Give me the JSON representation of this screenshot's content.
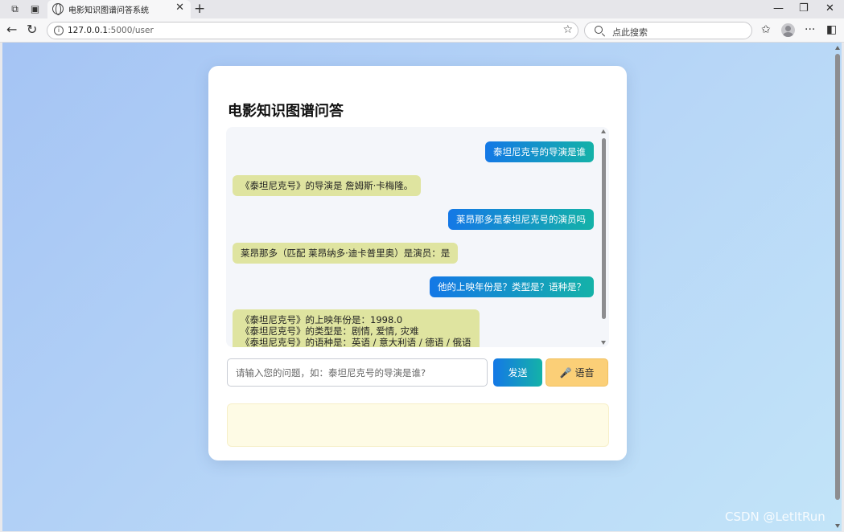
{
  "browser": {
    "tab_title": "电影知识图谱问答系统",
    "url_host": "127.0.0.1",
    "url_path": ":5000/user",
    "search_placeholder": "点此搜索",
    "tab_close": "✕",
    "new_tab": "+",
    "minimize": "—",
    "restore": "❐",
    "close": "✕"
  },
  "page": {
    "title": "电影知识图谱问答",
    "messages": [
      {
        "role": "user",
        "text": "泰坦尼克号的导演是谁"
      },
      {
        "role": "bot",
        "text": "《泰坦尼克号》的导演是 詹姆斯·卡梅隆。"
      },
      {
        "role": "user",
        "text": "莱昂那多是泰坦尼克号的演员吗"
      },
      {
        "role": "bot",
        "text": "莱昂那多（匹配 莱昂纳多·迪卡普里奥）是演员：是"
      },
      {
        "role": "user",
        "text": "他的上映年份是？类型是？语种是？"
      },
      {
        "role": "bot",
        "lines": [
          "《泰坦尼克号》的上映年份是：1998.0",
          "《泰坦尼克号》的类型是：剧情, 爱情, 灾难",
          "《泰坦尼克号》的语种是：英语 / 意大利语 / 德语 / 俄语"
        ]
      }
    ],
    "input_placeholder": "请输入您的问题，如：泰坦尼克号的导演是谁?",
    "send_label": "发送",
    "voice_label": "语音"
  },
  "watermark": "CSDN @LetItRun",
  "colors": {
    "user_bubble_start": "#1478e6",
    "user_bubble_end": "#14b2a8",
    "bot_bubble": "#dfe4a0",
    "voice_button": "#fbcf77",
    "result_panel": "#fefbe5"
  }
}
